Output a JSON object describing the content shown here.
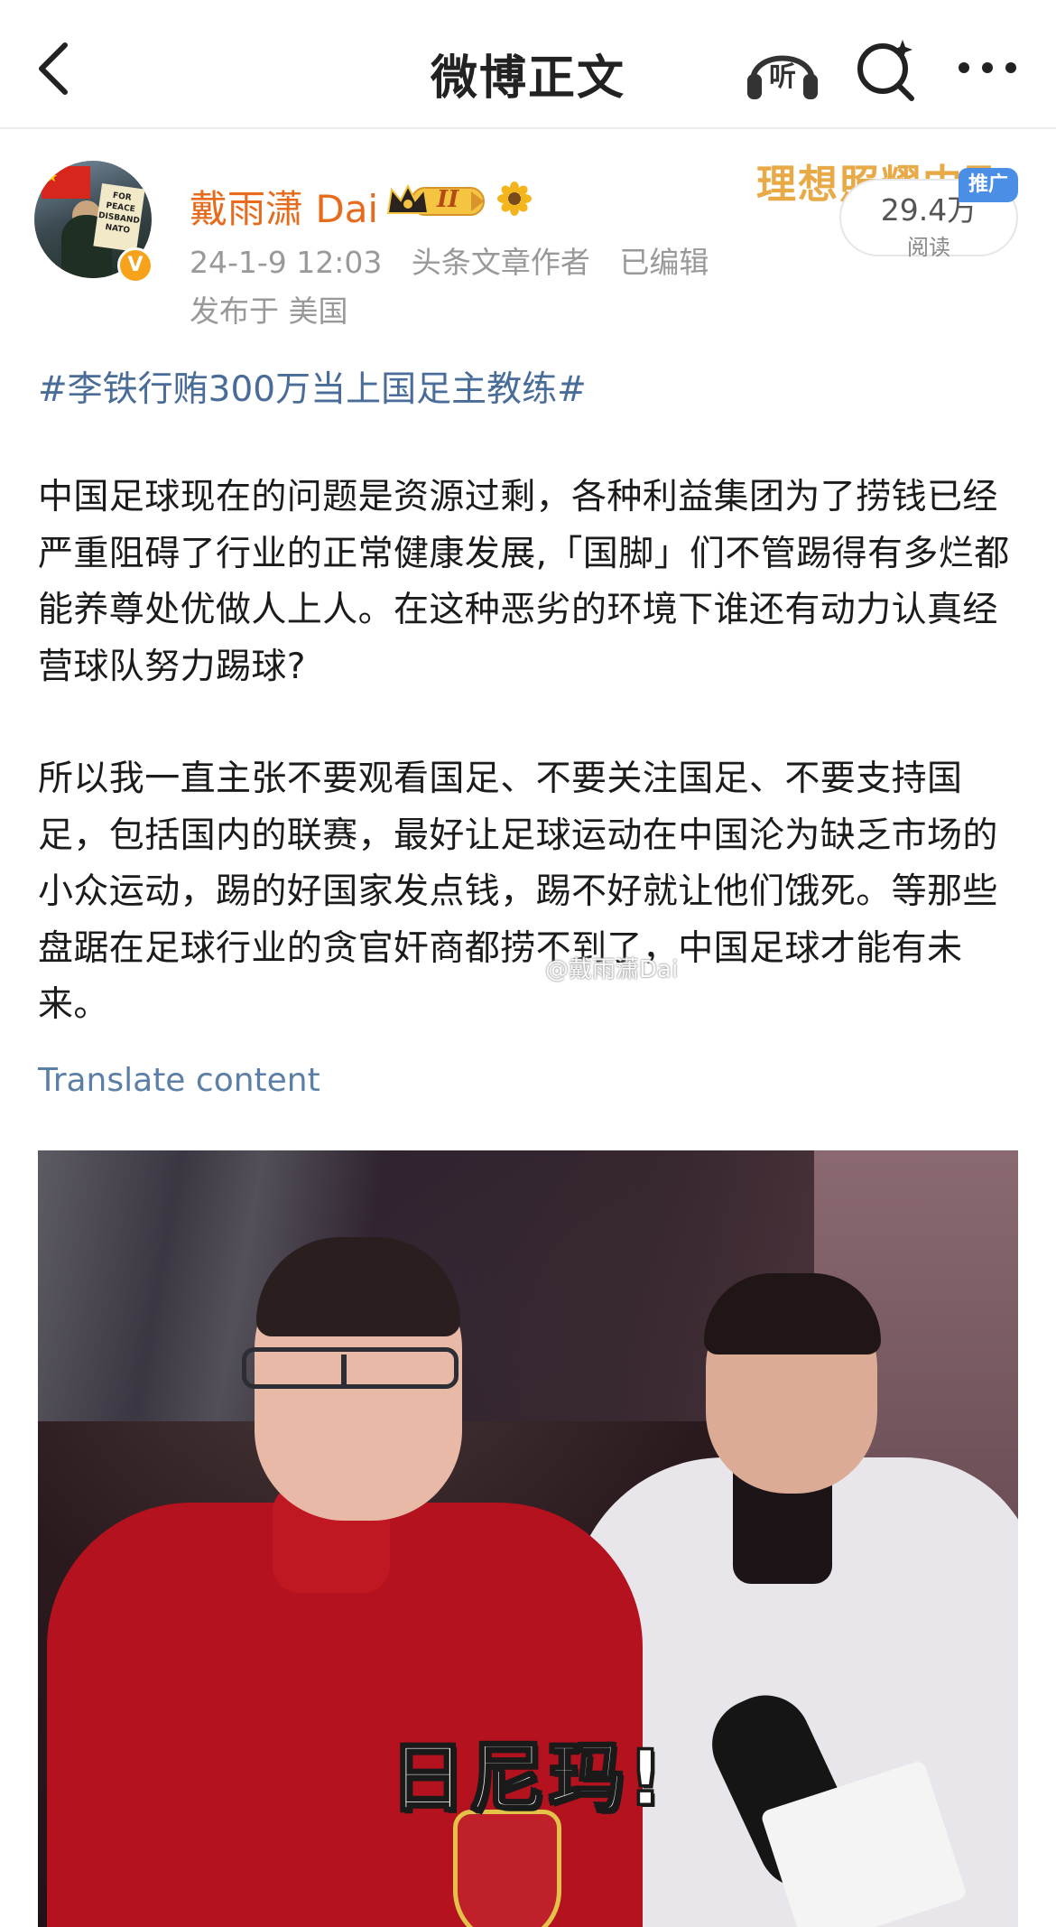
{
  "nav": {
    "title": "微博正文",
    "listen_label": "听",
    "back_icon": "chevron-left-icon",
    "search_icon": "search-icon",
    "more_icon": "more-dots-icon"
  },
  "author": {
    "name": "戴雨潇 Dai",
    "vip_level": "II",
    "timestamp": "24-1-9 12:03",
    "role": "头条文章作者",
    "edited": "已编辑",
    "location": "发布于 美国",
    "avatar_sign_text": "FOR PEACE DISBAND NATO",
    "verified_mark": "V"
  },
  "promo": {
    "banner_text": "理想照耀中国",
    "tag": "推广",
    "read_count": "29.4万",
    "read_label": "阅读"
  },
  "post": {
    "topic": "#李铁行贿300万当上国足主教练#",
    "paragraphs": [
      "中国足球现在的问题是资源过剩，各种利益集团为了捞钱已经严重阻碍了行业的正常健康发展,「国脚」们不管踢得有多烂都能养尊处优做人上人。在这种恶劣的环境下谁还有动力认真经营球队努力踢球?",
      "所以我一直主张不要观看国足、不要关注国足、不要支持国足，包括国内的联赛，最好让足球运动在中国沦为缺乏市场的小众运动，踢的好国家发点钱，踢不好就让他们饿死。等那些盘踞在足球行业的贪官奸商都捞不到了，中国足球才能有未来。"
    ],
    "watermark": "@戴雨潇Dai",
    "translate_label": "Translate content",
    "image_caption": "日尼玛!"
  },
  "colors": {
    "author_name": "#e66b1d",
    "topic_link": "#4a6c99",
    "meta_gray": "#999999",
    "promo_tag": "#4a8ee6",
    "translate_link": "#5b7fa6",
    "banner_gold": "#e6a034"
  }
}
